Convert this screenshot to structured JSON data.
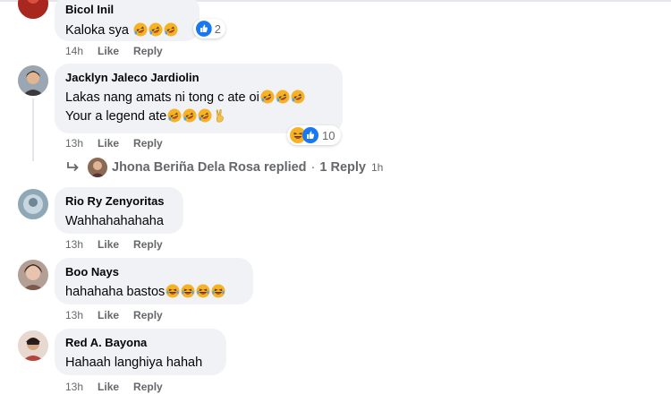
{
  "comments": [
    {
      "author": "Bicol Inil",
      "lines": [
        "Kaloka sya"
      ],
      "time": "14h",
      "like_label": "Like",
      "reply_label": "Reply",
      "reaction_count": "2"
    },
    {
      "author": "Jacklyn Jaleco Jardiolin",
      "lines": [
        "Lakas nang amats ni tong c ate oi",
        "Your a legend ate"
      ],
      "time": "13h",
      "like_label": "Like",
      "reply_label": "Reply",
      "reaction_count": "10"
    },
    {
      "author": "Rio Ry Zenyoritas",
      "lines": [
        "Wahhahahahaha"
      ],
      "time": "13h",
      "like_label": "Like",
      "reply_label": "Reply"
    },
    {
      "author": "Boo Nays",
      "lines": [
        "hahahaha bastos"
      ],
      "time": "13h",
      "like_label": "Like",
      "reply_label": "Reply"
    },
    {
      "author": "Red A. Bayona",
      "lines": [
        "Hahaah langhiya hahah"
      ],
      "time": "13h",
      "like_label": "Like",
      "reply_label": "Reply"
    }
  ],
  "reply_summary": {
    "replier": "Jhona Beriña Dela Rosa",
    "replied_label": "replied",
    "separator": "·",
    "count_label": "1 Reply",
    "time": "1h"
  },
  "icons": {
    "emoji": "rofl-emoji",
    "laugh_emoji": "laughing-emoji",
    "like_reaction": "like-reaction-icon",
    "haha_reaction": "haha-reaction-icon",
    "reply_arrow": "reply-arrow-icon",
    "victory_hand": "victory-hand-emoji"
  },
  "colors": {
    "bubble": "#f0f2f5",
    "meta_text": "#65676b",
    "like_blue": "#1877f2",
    "emoji_yellow": "#f7b125"
  }
}
